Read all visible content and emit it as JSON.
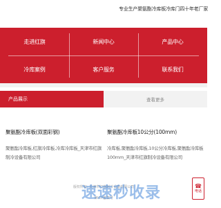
{
  "header": {
    "tagline": "专业生产聚氨酯冷库板冷库门四十年老厂家"
  },
  "nav": {
    "items": [
      {
        "label": "走进红旗"
      },
      {
        "label": "新闻中心"
      },
      {
        "label": "产品中心"
      },
      {
        "label": "冷库案例"
      },
      {
        "label": "客户服务"
      },
      {
        "label": "联系我们"
      }
    ]
  },
  "products_section": {
    "tab_label": "产品展示",
    "more_label": "查看更多"
  },
  "products": [
    {
      "title": "聚氨酯冷库板(双面彩钢)",
      "description": "聚氨酯冷库板,红旗冷库板,冷库冷库板_天津市红旗制冷设备有限公司"
    },
    {
      "title": "聚氨酯冷库板10公分(100mm)",
      "description": "冷库板,聚氨酯冷库板,10公分冷库板,聚氨酯冷库板100mm_天津市红旗制冷设备有限公司"
    }
  ],
  "footer": {
    "line1": "版权所有: 天津市红旗制冷设备有限公司",
    "line2": "津ICP备案号"
  },
  "watermark": {
    "text": "速速秒收录"
  },
  "float_button": {
    "label": "电话"
  },
  "colors": {
    "brand_red": "#cc1f2d",
    "watermark_blue": "#3a7fd6"
  }
}
